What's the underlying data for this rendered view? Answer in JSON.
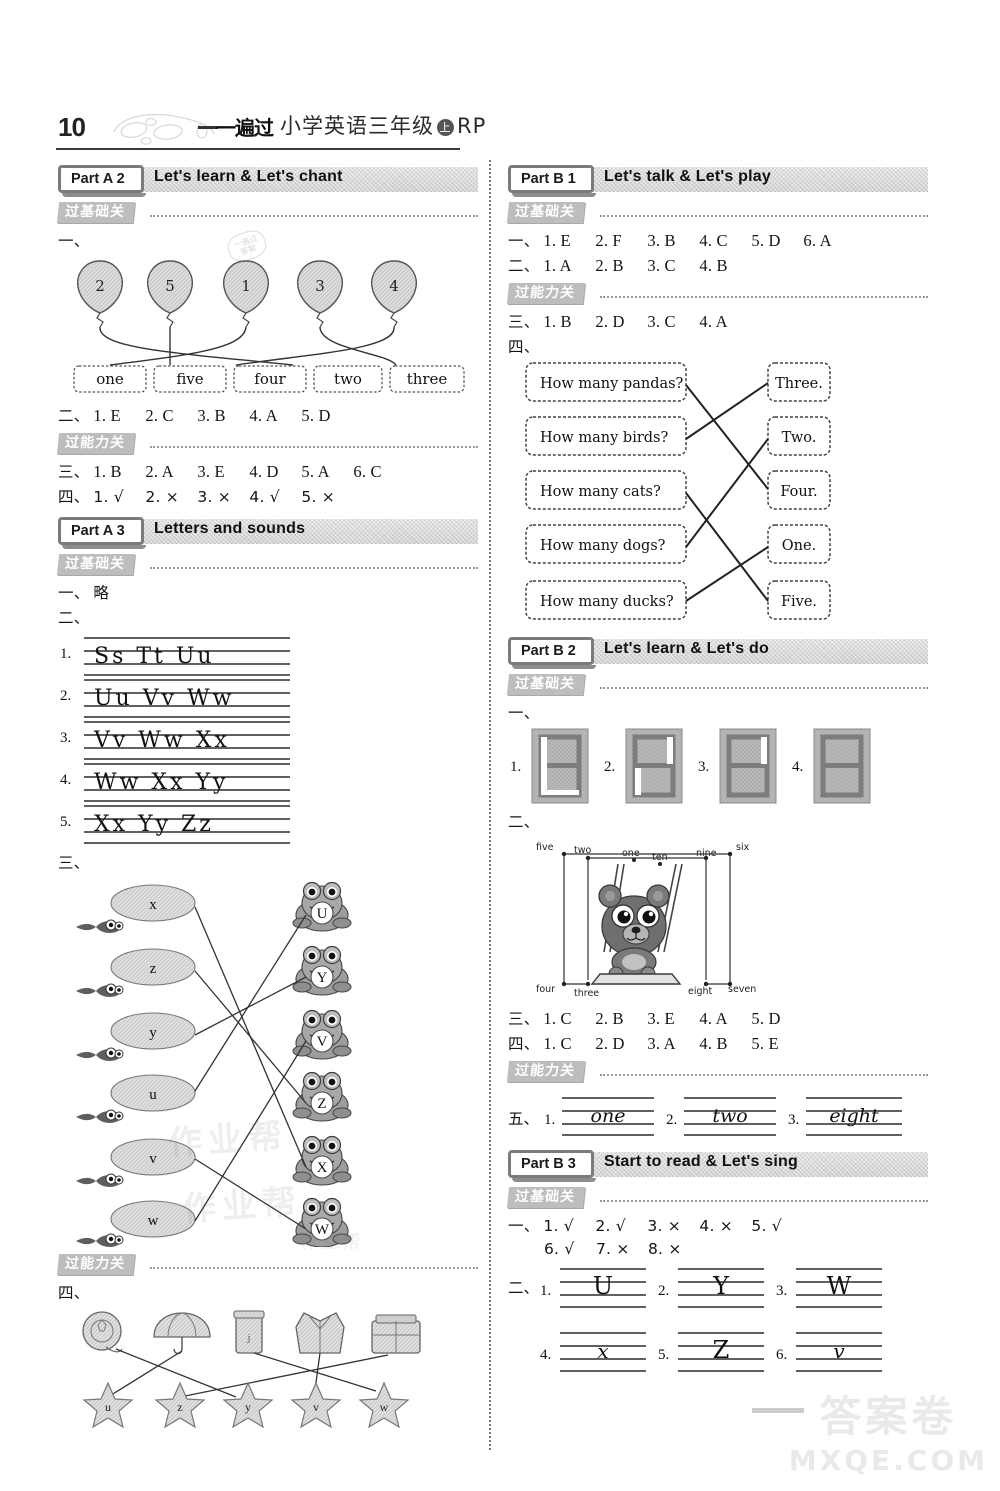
{
  "header": {
    "page_number": "10",
    "brand": "一遍过",
    "title": "小学英语三年级",
    "badge": "上",
    "edition": "RP"
  },
  "labels": {
    "gate_basic": "过基础关",
    "gate_ability": "过能力关",
    "num1": "一、",
    "num2": "二、",
    "num3": "三、",
    "num4": "四、",
    "num5": "五、",
    "omitted": "略"
  },
  "left_column": {
    "partA2": {
      "tab": "Part A 2",
      "title": "Let's learn  & Let's chant",
      "exercise1": {
        "balloons": [
          "2",
          "5",
          "1",
          "3",
          "4"
        ],
        "words": [
          "one",
          "five",
          "four",
          "two",
          "three"
        ],
        "matches": [
          [
            0,
            3
          ],
          [
            1,
            1
          ],
          [
            2,
            2
          ],
          [
            3,
            4
          ],
          [
            4,
            0
          ]
        ]
      },
      "answers2": [
        "1. E",
        "2. C",
        "3. B",
        "4. A",
        "5. D"
      ],
      "answers3": [
        "1. B",
        "2. A",
        "3. E",
        "4. D",
        "5. A",
        "6. C"
      ],
      "answers4": [
        "1. √",
        "2. ×",
        "3. ×",
        "4. √",
        "5. ×"
      ]
    },
    "partA3": {
      "tab": "Part A 3",
      "title": "Letters and sounds",
      "answer1": "略",
      "handwriting_rows": [
        {
          "num": "1.",
          "text": "Ss  Tt  Uu"
        },
        {
          "num": "2.",
          "text": "Uu  Vv  Ww"
        },
        {
          "num": "3.",
          "text": "Vv  Ww  Xx"
        },
        {
          "num": "4.",
          "text": "Ww  Xx  Yy"
        },
        {
          "num": "5.",
          "text": "Xx  Yy  Zz"
        }
      ],
      "frog_match": {
        "bugs": [
          "x",
          "z",
          "y",
          "u",
          "v",
          "w"
        ],
        "frogs": [
          "U",
          "Y",
          "V",
          "Z",
          "W",
          "X"
        ],
        "matches": [
          [
            0,
            5
          ],
          [
            1,
            3
          ],
          [
            2,
            1
          ],
          [
            3,
            0
          ],
          [
            4,
            4
          ],
          [
            5,
            2
          ]
        ]
      },
      "star_match": {
        "objects": [
          "yo-yo",
          "umbrella",
          "jar",
          "vest",
          "zip-bag"
        ],
        "stars": [
          "u",
          "z",
          "y",
          "v",
          "w"
        ],
        "matches": [
          [
            0,
            2
          ],
          [
            1,
            0
          ],
          [
            2,
            4
          ],
          [
            3,
            3
          ],
          [
            4,
            1
          ]
        ]
      }
    }
  },
  "right_column": {
    "partB1": {
      "tab": "Part B 1",
      "title": "Let's talk & Let's play",
      "answers1": [
        "1. E",
        "2. F",
        "3. B",
        "4. C",
        "5. D",
        "6. A"
      ],
      "answers2": [
        "1. A",
        "2. B",
        "3. C",
        "4. B"
      ],
      "answers3": [
        "1. B",
        "2. D",
        "3. C",
        "4. A"
      ],
      "question_match": {
        "questions": [
          "How many pandas?",
          "How many birds?",
          "How many cats?",
          "How many dogs?",
          "How many ducks?"
        ],
        "answers": [
          "Three.",
          "Two.",
          "Four.",
          "One.",
          "Five."
        ],
        "matches": [
          [
            0,
            2
          ],
          [
            1,
            0
          ],
          [
            2,
            4
          ],
          [
            3,
            1
          ],
          [
            4,
            3
          ]
        ]
      }
    },
    "partB2": {
      "tab": "Part B 2",
      "title": "Let's learn  & Let's do",
      "digits": [
        "1.",
        "2.",
        "3.",
        "4."
      ],
      "dot_to_dot": {
        "top_labels": [
          "five",
          "two",
          "one",
          "ten",
          "nine",
          "six"
        ],
        "bottom_labels": [
          "four",
          "three",
          "eight",
          "seven"
        ],
        "subject": "bear-on-swing"
      },
      "answers3": [
        "1. C",
        "2. B",
        "3. E",
        "4. A",
        "5. D"
      ],
      "answers4": [
        "1. C",
        "2. D",
        "3. A",
        "4. B",
        "5. E"
      ],
      "answers5": [
        {
          "num": "1.",
          "word": "one"
        },
        {
          "num": "2.",
          "word": "two"
        },
        {
          "num": "3.",
          "word": "eight"
        }
      ]
    },
    "partB3": {
      "tab": "Part B 3",
      "title": "Start to read & Let's sing",
      "answers1_line1": [
        "1. √",
        "2. √",
        "3. ×",
        "4. ×",
        "5. √"
      ],
      "answers1_line2": [
        "6. √",
        "7. ×",
        "8. ×"
      ],
      "answers2": [
        {
          "num": "1.",
          "letter": "U"
        },
        {
          "num": "2.",
          "letter": "Y"
        },
        {
          "num": "3.",
          "letter": "W"
        },
        {
          "num": "4.",
          "letter": "x"
        },
        {
          "num": "5.",
          "letter": "Z"
        },
        {
          "num": "6.",
          "letter": "v"
        }
      ]
    }
  },
  "watermarks": {
    "corner_cn": "答案卷",
    "corner_en": "MXQE.COM",
    "body_text": "作业帮"
  }
}
